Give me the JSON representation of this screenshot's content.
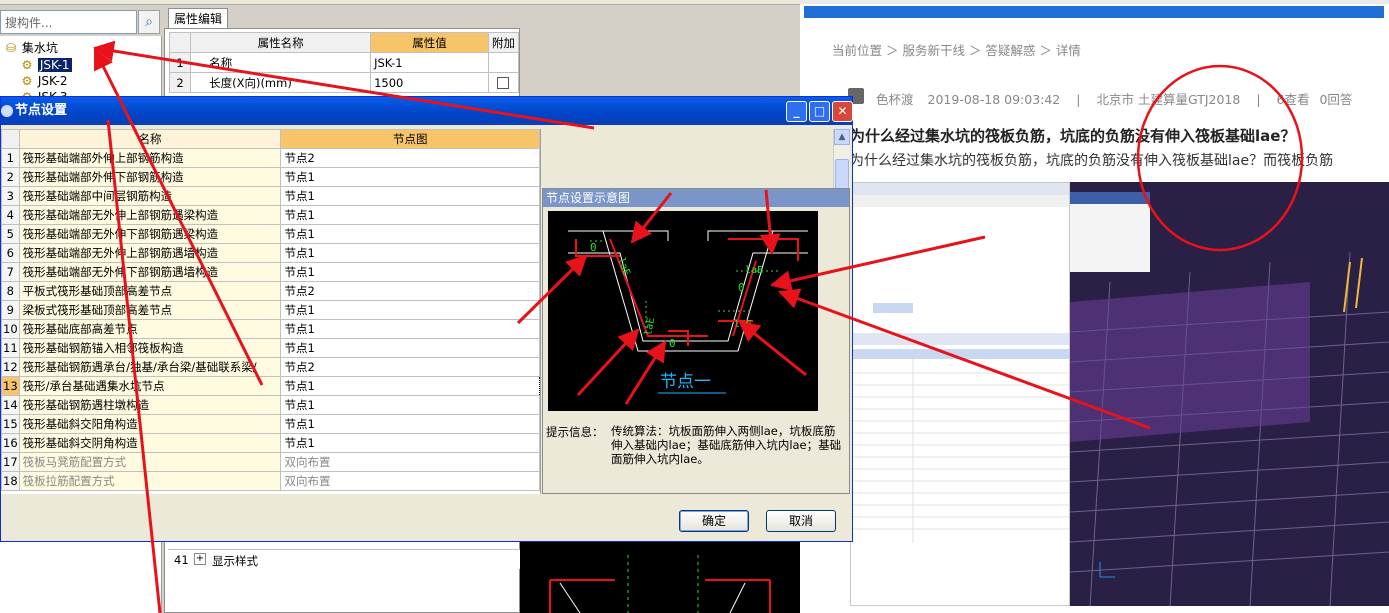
{
  "left_app": {
    "search_placeholder": "搜构件...",
    "tree": {
      "root": "集水坑",
      "items": [
        "JSK-1",
        "JSK-2",
        "JSK-3"
      ]
    },
    "prop_tab": "属性编辑",
    "prop_table": {
      "headers": [
        "属性名称",
        "属性值",
        "附加"
      ],
      "rows": [
        {
          "num": "1",
          "name": "名称",
          "value": "JSK-1"
        },
        {
          "num": "2",
          "name": "长度(X向)(mm)",
          "value": "1500"
        }
      ],
      "bottom_row": {
        "num": "41",
        "toggle": "+",
        "name": "显示样式"
      }
    }
  },
  "dialog": {
    "title": "节点设置",
    "headers": [
      "名称",
      "节点图"
    ],
    "rows": [
      {
        "num": "1",
        "name": "筏形基础端部外伸上部钢筋构造",
        "value": "节点2"
      },
      {
        "num": "2",
        "name": "筏形基础端部外伸下部钢筋构造",
        "value": "节点1"
      },
      {
        "num": "3",
        "name": "筏形基础端部中间层钢筋构造",
        "value": "节点1"
      },
      {
        "num": "4",
        "name": "筏形基础端部无外伸上部钢筋遇梁构造",
        "value": "节点1"
      },
      {
        "num": "5",
        "name": "筏形基础端部无外伸下部钢筋遇梁构造",
        "value": "节点1"
      },
      {
        "num": "6",
        "name": "筏形基础端部无外伸上部钢筋遇墙构造",
        "value": "节点1"
      },
      {
        "num": "7",
        "name": "筏形基础端部无外伸下部钢筋遇墙构造",
        "value": "节点1"
      },
      {
        "num": "8",
        "name": "平板式筏形基础顶部高差节点",
        "value": "节点2"
      },
      {
        "num": "9",
        "name": "梁板式筏形基础顶部高差节点",
        "value": "节点1"
      },
      {
        "num": "10",
        "name": "筏形基础底部高差节点",
        "value": "节点1"
      },
      {
        "num": "11",
        "name": "筏形基础钢筋锚入相邻筏板构造",
        "value": "节点1"
      },
      {
        "num": "12",
        "name": "筏形基础钢筋遇承台/独基/承台梁/基础联系梁/",
        "value": "节点2"
      },
      {
        "num": "13",
        "name": "筏形/承台基础遇集水坑节点",
        "value": "节点1"
      },
      {
        "num": "14",
        "name": "筏形基础钢筋遇柱墩构造",
        "value": "节点1"
      },
      {
        "num": "15",
        "name": "筏形基础斜交阳角构造",
        "value": "节点1"
      },
      {
        "num": "16",
        "name": "筏形基础斜交阴角构造",
        "value": "节点1"
      },
      {
        "num": "17",
        "name": "筏板马凳筋配置方式",
        "value": "双向布置"
      },
      {
        "num": "18",
        "name": "筏板拉筋配置方式",
        "value": "双向布置"
      }
    ],
    "selected_row": "13",
    "diagram": {
      "title": "节点设置示意图",
      "labels": {
        "lae_top_left": "laE",
        "lae_top_right": "laE",
        "lae_bottom_left": "laE",
        "lae_bottom_right": "laE",
        "zero_a": "0",
        "zero_b": "0",
        "zero_c": "0"
      },
      "caption": "节点一",
      "hint_label": "提示信息：",
      "hint_text": "传统算法：坑板面筋伸入两侧lae，坑板底筋伸入基础内lae；基础底筋伸入坑内lae；基础面筋伸入坑内lae。"
    },
    "ok": "确定",
    "cancel": "取消"
  },
  "web": {
    "breadcrumb": "当前位置 ＞ 服务新干线 ＞ 答疑解惑 ＞ 详情",
    "meta": {
      "user": "色杯渡",
      "datetime": "2019-08-18 09:03:42",
      "location": "北京市",
      "category": "土建算量GTJ2018",
      "views": "6查看",
      "answers": "0回答"
    },
    "question_title": "为什么经过集水坑的筏板负筋，坑底的负筋没有伸入筏板基础lae？",
    "question_body": "为什么经过集水坑的筏板负筋，坑底的负筋没有伸入筏板基础lae？而筏板负筋"
  },
  "colors": {
    "title_blue": "#0a5ce8",
    "header_orange": "#f8c46a",
    "annotation_red": "#e8121b",
    "web_blue": "#1f6fd6"
  }
}
